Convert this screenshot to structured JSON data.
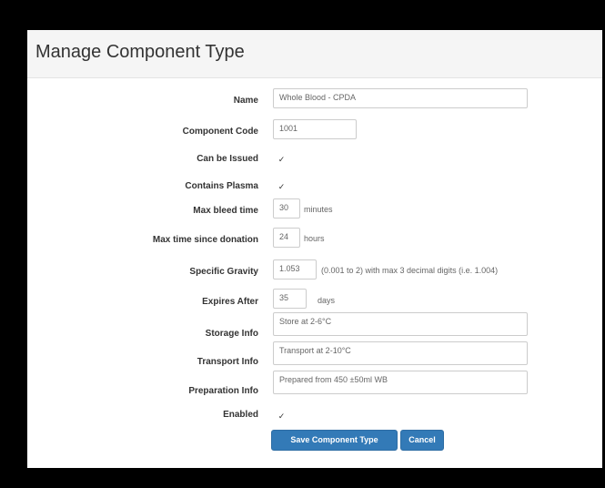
{
  "page_title": "Manage Component Type",
  "form": {
    "name_label": "Name",
    "name_value": "Whole Blood - CPDA",
    "component_code_label": "Component Code",
    "component_code_value": "1001",
    "can_be_issued_label": "Can be Issued",
    "can_be_issued_checked": true,
    "contains_plasma_label": "Contains Plasma",
    "contains_plasma_checked": true,
    "max_bleed_time_label": "Max bleed time",
    "max_bleed_time_value": "30",
    "max_bleed_time_unit": "minutes",
    "max_time_since_donation_label": "Max time since donation",
    "max_time_since_donation_value": "24",
    "max_time_since_donation_unit": "hours",
    "specific_gravity_label": "Specific Gravity",
    "specific_gravity_value": "1.053",
    "specific_gravity_hint": "(0.001 to 2) with max 3 decimal digits (i.e. 1.004)",
    "expires_after_label": "Expires After",
    "expires_after_value": "35",
    "expires_after_unit": "days",
    "storage_info_label": "Storage Info",
    "storage_info_value": "Store at 2-6°C",
    "transport_info_label": "Transport Info",
    "transport_info_value": "Transport at 2-10°C",
    "preparation_info_label": "Preparation Info",
    "preparation_info_value": "Prepared from 450 ±50ml WB",
    "enabled_label": "Enabled",
    "enabled_checked": true
  },
  "buttons": {
    "save_label": "Save Component Type",
    "cancel_label": "Cancel"
  },
  "icons": {
    "checkbox": "checkmark-icon"
  },
  "colors": {
    "primary": "#337ab7",
    "header_bg": "#f5f5f5"
  }
}
